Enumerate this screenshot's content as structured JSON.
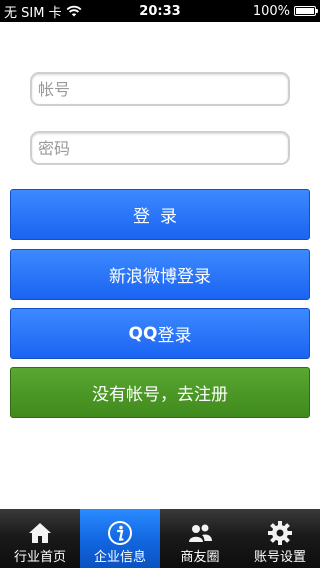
{
  "status_bar": {
    "carrier": "无 SIM 卡",
    "time": "20:33",
    "battery": "100%"
  },
  "login_form": {
    "account_placeholder": "帐号",
    "password_placeholder": "密码"
  },
  "buttons": {
    "login": "登录",
    "weibo_prefix": "新浪微博登录",
    "qq_bold": "QQ",
    "qq_suffix": "登录",
    "register": "没有帐号，去注册"
  },
  "tabs": [
    {
      "label": "行业首页",
      "icon": "home-icon",
      "active": false
    },
    {
      "label": "企业信息",
      "icon": "info-icon",
      "active": true
    },
    {
      "label": "商友圈",
      "icon": "friends-icon",
      "active": false
    },
    {
      "label": "账号设置",
      "icon": "gear-icon",
      "active": false
    }
  ],
  "colors": {
    "primary_blue": "#1a64f2",
    "register_green": "#4a9626",
    "tab_active": "#1166e0"
  }
}
